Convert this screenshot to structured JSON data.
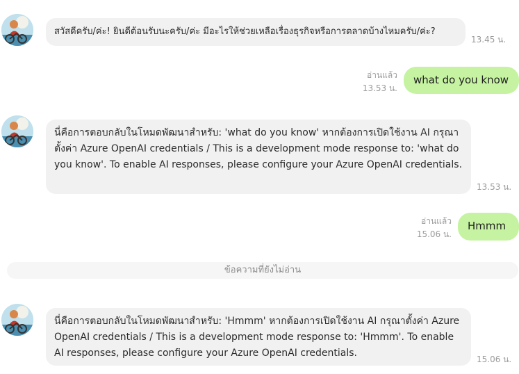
{
  "messages": [
    {
      "text": "สวัสดีครับ/ค่ะ! ยินดีต้อนรับนะครับ/ค่ะ มีอะไรให้ช่วยเหลือเรื่องธุรกิจหรือการตลาดบ้างไหมครับ/ค่ะ?",
      "time": "13.45 น."
    },
    {
      "text": "what do you know",
      "read": "อ่านแล้ว",
      "time": "13.53 น."
    },
    {
      "text": "นี่คือการตอบกลับในโหมดพัฒนาสำหรับ: 'what do you know' หากต้องการเปิดใช้งาน AI กรุณาตั้งค่า Azure OpenAI credentials / This is a development mode response to: 'what do you know'. To enable AI responses, please configure your Azure OpenAI credentials.",
      "time": "13.53 น."
    },
    {
      "text": "Hmmm",
      "read": "อ่านแล้ว",
      "time": "15.06 น."
    },
    {
      "text": "นี่คือการตอบกลับในโหมดพัฒนาสำหรับ: 'Hmmm' หากต้องการเปิดใช้งาน AI กรุณาตั้งค่า Azure OpenAI credentials / This is a development mode response to: 'Hmmm'. To enable AI responses, please configure your Azure OpenAI credentials.",
      "time": "15.06 น."
    }
  ],
  "unread_divider": "ข้อความที่ยังไม่อ่าน",
  "colors": {
    "incoming_bubble": "#f1f1f2",
    "outgoing_bubble": "#c5f3a1",
    "meta_text": "#9a9a9a"
  },
  "avatar_icon": "bot-avatar-icon"
}
